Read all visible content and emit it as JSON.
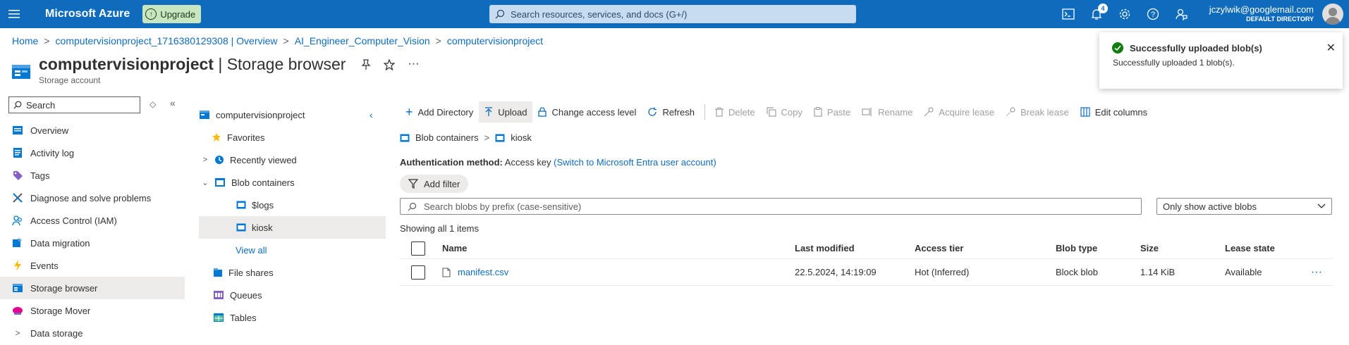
{
  "topbar": {
    "brand": "Microsoft Azure",
    "upgrade_label": "Upgrade",
    "search_placeholder": "Search resources, services, and docs (G+/)",
    "notifications_count": "4",
    "account_email": "jczylwik@googlemail.com",
    "account_directory": "DEFAULT DIRECTORY"
  },
  "breadcrumb": [
    "Home",
    "computervisionproject_1716380129308 | Overview",
    "AI_Engineer_Computer_Vision",
    "computervisionproject"
  ],
  "page": {
    "title_bold": "computervisionproject",
    "title_rest": " | Storage browser",
    "subtitle": "Storage account"
  },
  "sidebar": {
    "search_placeholder": "Search",
    "items": [
      {
        "label": "Overview"
      },
      {
        "label": "Activity log"
      },
      {
        "label": "Tags"
      },
      {
        "label": "Diagnose and solve problems"
      },
      {
        "label": "Access Control (IAM)"
      },
      {
        "label": "Data migration"
      },
      {
        "label": "Events"
      },
      {
        "label": "Storage browser"
      },
      {
        "label": "Storage Mover"
      },
      {
        "label": "Data storage"
      }
    ]
  },
  "tree": {
    "root": "computervisionproject",
    "favorites": "Favorites",
    "recently_viewed": "Recently viewed",
    "blob_containers": "Blob containers",
    "logs": "$logs",
    "kiosk": "kiosk",
    "view_all": "View all",
    "file_shares": "File shares",
    "queues": "Queues",
    "tables": "Tables"
  },
  "toolbar": {
    "add_directory": "Add Directory",
    "upload": "Upload",
    "change_access": "Change access level",
    "refresh": "Refresh",
    "delete": "Delete",
    "copy": "Copy",
    "paste": "Paste",
    "rename": "Rename",
    "acquire_lease": "Acquire lease",
    "break_lease": "Break lease",
    "edit_columns": "Edit columns"
  },
  "content": {
    "crumb_root": "Blob containers",
    "crumb_current": "kiosk",
    "auth_label": "Authentication method:",
    "auth_value": "Access key",
    "auth_switch": "(Switch to Microsoft Entra user account)",
    "add_filter": "Add filter",
    "search_placeholder": "Search blobs by prefix (case-sensitive)",
    "dropdown_value": "Only show active blobs",
    "showing": "Showing all 1 items"
  },
  "table": {
    "headers": [
      "Name",
      "Last modified",
      "Access tier",
      "Blob type",
      "Size",
      "Lease state"
    ],
    "rows": [
      {
        "name": "manifest.csv",
        "modified": "22.5.2024, 14:19:09",
        "tier": "Hot (Inferred)",
        "type": "Block blob",
        "size": "1.14 KiB",
        "lease": "Available"
      }
    ]
  },
  "toast": {
    "title": "Successfully uploaded blob(s)",
    "message": "Successfully uploaded 1 blob(s)."
  }
}
